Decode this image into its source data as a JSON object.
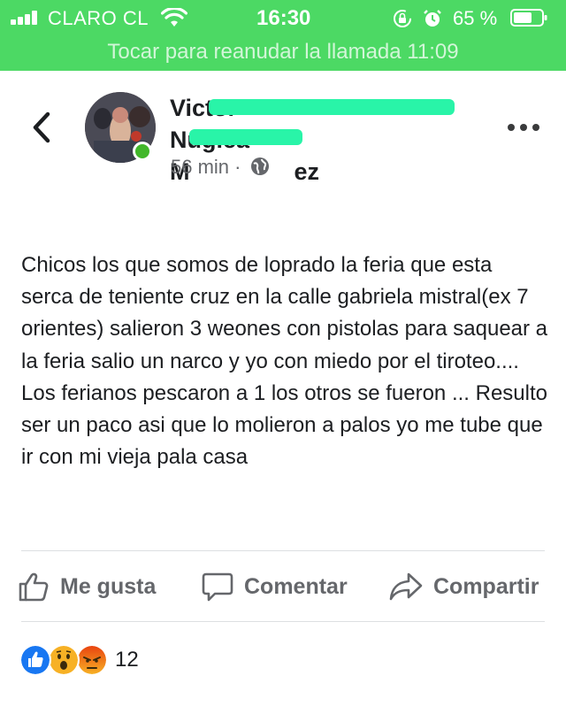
{
  "status_bar": {
    "carrier": "CLARO CL",
    "time": "16:30",
    "battery": "65 %"
  },
  "call_banner": {
    "text": "Tocar para reanudar la llamada 11:09"
  },
  "post": {
    "author_visible_1": "Victor",
    "author_visible_2": "Nugica",
    "author_visible_3": "M",
    "author_visible_4": "ez",
    "time_ago": "56 min",
    "separator": "·",
    "body": "Chicos los que somos de loprado la feria que esta serca de teniente cruz en la calle gabriela mistral(ex 7 orientes) salieron 3 weones con pistolas para saquear a la feria salio un narco y yo con miedo por el tiroteo.... Los ferianos pescaron a 1 los otros se fueron ... Resulto ser un paco asi que lo molieron a palos yo me tube que ir con mi vieja pala casa"
  },
  "actions": {
    "like": "Me gusta",
    "comment": "Comentar",
    "share": "Compartir"
  },
  "reactions": {
    "icons": [
      "like-icon",
      "wow-icon",
      "angry-icon"
    ],
    "count": "12"
  },
  "colors": {
    "status_green": "#4cd964",
    "redaction": "#29f4a8",
    "facebook_blue": "#1877f2",
    "muted_text": "#65676b"
  }
}
